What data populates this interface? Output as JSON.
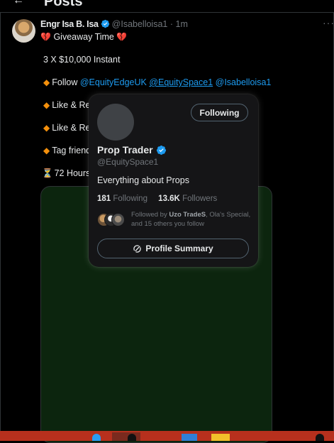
{
  "header": {
    "title": "Posts",
    "back_icon": "back-arrow-icon"
  },
  "post": {
    "author_name": "Engr Isa B. Isa",
    "author_handle": "@Isabelloisa1",
    "separator": "·",
    "time": "1m",
    "verified_color": "#1d9bf0",
    "lines": {
      "giveaway": "Giveaway Time",
      "amount": "3 X $10,000 Instant",
      "follow_label": "Follow",
      "mention_1": "@EquityEdgeUK",
      "mention_2": "@EquitySpace1",
      "mention_3": "@Isabelloisa1",
      "like_1": "Like & Rep",
      "like_2": "Like & Rep",
      "tag": "Tag friend",
      "hours": "72 Hours"
    }
  },
  "hover_card": {
    "follow_button": "Following",
    "name": "Prop Trader",
    "handle": "@EquitySpace1",
    "bio": "Everything about Props",
    "following_count": "181",
    "following_label": "Following",
    "followers_count": "13.6K",
    "followers_label": "Followers",
    "followed_by_prefix": "Followed by",
    "followed_by_name": "Uzo TradeS",
    "followed_by_rest": ", Ola's Special, and 15 others you follow",
    "summary_button": "Profile Summary"
  },
  "colors": {
    "accent": "#1d9bf0",
    "background": "#000000",
    "card": "#151517",
    "media": "#0c250e",
    "taskbar": "#b7301d"
  }
}
